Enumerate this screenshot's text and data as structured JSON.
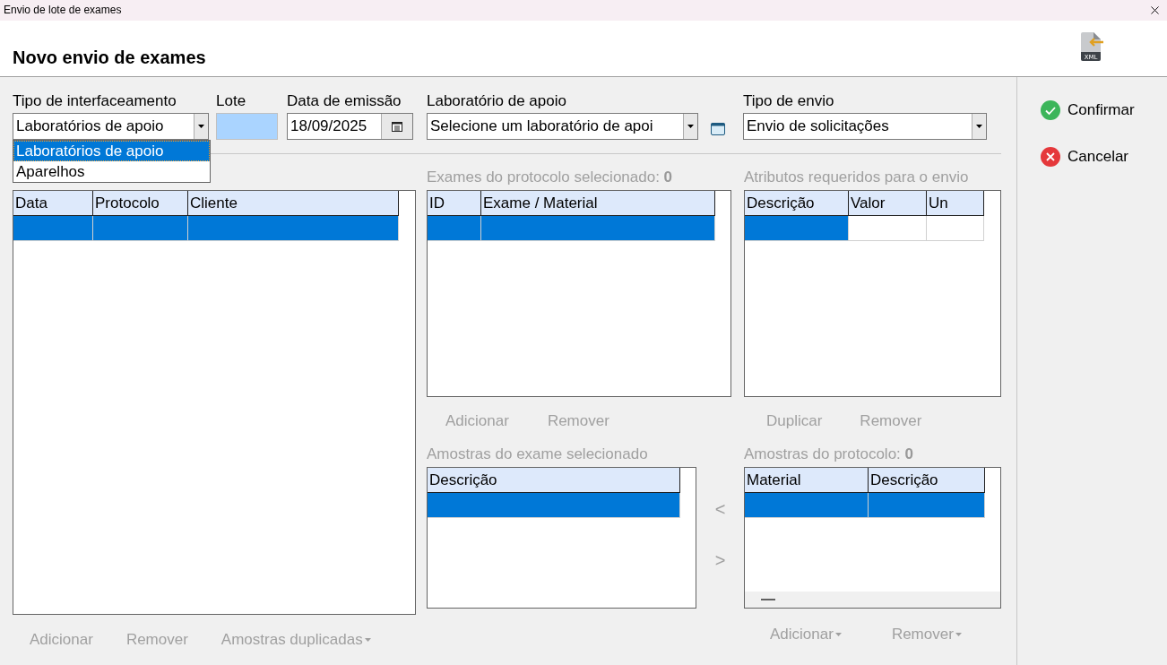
{
  "window": {
    "title": "Envio de lote de exames"
  },
  "header": {
    "title": "Novo envio de exames",
    "icon_label": "XML"
  },
  "fields": [
    {
      "kind": "combo",
      "label": "Tipo de interfaceamento",
      "value": "Laboratórios de apoio",
      "open": true,
      "options": [
        {
          "label": "Laboratórios de apoio",
          "selected": true
        },
        {
          "label": "Aparelhos",
          "selected": false
        }
      ]
    },
    {
      "kind": "text",
      "label": "Lote",
      "highlighted": true
    },
    {
      "kind": "date",
      "label": "Data de emissão",
      "value": "18/09/2025"
    },
    {
      "kind": "combo",
      "label": "Laboratório de apoio",
      "value": "Selecione um laboratório de apoi",
      "browse": true
    },
    {
      "kind": "combo",
      "label": "Tipo de envio",
      "value": "Envio de solicitações"
    }
  ],
  "protocols": {
    "grid": {
      "columns": [
        {
          "label": "Data"
        },
        {
          "label": "Protocolo"
        },
        {
          "label": "Cliente"
        }
      ],
      "rows": [
        {
          "cells": [
            {
              "selected": true
            },
            {
              "selected": true
            },
            {
              "selected": true
            }
          ]
        }
      ]
    },
    "buttons": [
      {
        "label": "Adicionar",
        "disabled": true,
        "dropdown": false
      },
      {
        "label": "Remover",
        "disabled": true,
        "dropdown": false
      },
      {
        "label": "Amostras duplicadas",
        "disabled": true,
        "dropdown": true
      }
    ]
  },
  "exams": {
    "label": "Exames do protocolo selecionado: **0**",
    "grid": {
      "columns": [
        {
          "label": "ID"
        },
        {
          "label": "Exame / Material"
        }
      ],
      "rows": [
        {
          "cells": [
            {
              "selected": true
            },
            {
              "selected": true
            }
          ]
        }
      ]
    },
    "buttons": [
      {
        "label": "Adicionar",
        "disabled": true,
        "dropdown": false
      },
      {
        "label": "Remover",
        "disabled": true,
        "dropdown": false
      }
    ]
  },
  "attributes": {
    "label": "Atributos requeridos para o envio",
    "grid": {
      "columns": [
        {
          "label": "Descrição"
        },
        {
          "label": "Valor"
        },
        {
          "label": "Un"
        }
      ],
      "rows": [
        {
          "cells": [
            {
              "selected": true
            },
            {
              "selected": false
            },
            {
              "selected": false
            }
          ]
        }
      ]
    },
    "buttons": [
      {
        "label": "Duplicar",
        "disabled": true,
        "dropdown": false
      },
      {
        "label": "Remover",
        "disabled": true,
        "dropdown": false
      }
    ]
  },
  "exam_samples": {
    "label": "Amostras do exame selecionado",
    "grid": {
      "columns": [
        {
          "label": "Descrição"
        }
      ],
      "rows": [
        {
          "cells": [
            {
              "selected": true
            }
          ]
        }
      ]
    }
  },
  "transfer_buttons": [
    {
      "label": "<",
      "disabled": true
    },
    {
      "label": ">",
      "disabled": true
    }
  ],
  "protocol_samples": {
    "label": "Amostras do protocolo: **0**",
    "grid": {
      "columns": [
        {
          "label": "Material"
        },
        {
          "label": "Descrição"
        }
      ],
      "rows": [
        {
          "cells": [
            {
              "selected": true
            },
            {
              "selected": true
            }
          ]
        }
      ],
      "horizontal_scrollbar": true
    },
    "buttons": [
      {
        "label": "Adicionar",
        "disabled": true,
        "dropdown": true
      },
      {
        "label": "Remover",
        "disabled": true,
        "dropdown": true
      }
    ]
  },
  "actions": [
    {
      "kind": "confirm",
      "label": "Confirmar"
    },
    {
      "kind": "cancel",
      "label": "Cancelar"
    }
  ]
}
